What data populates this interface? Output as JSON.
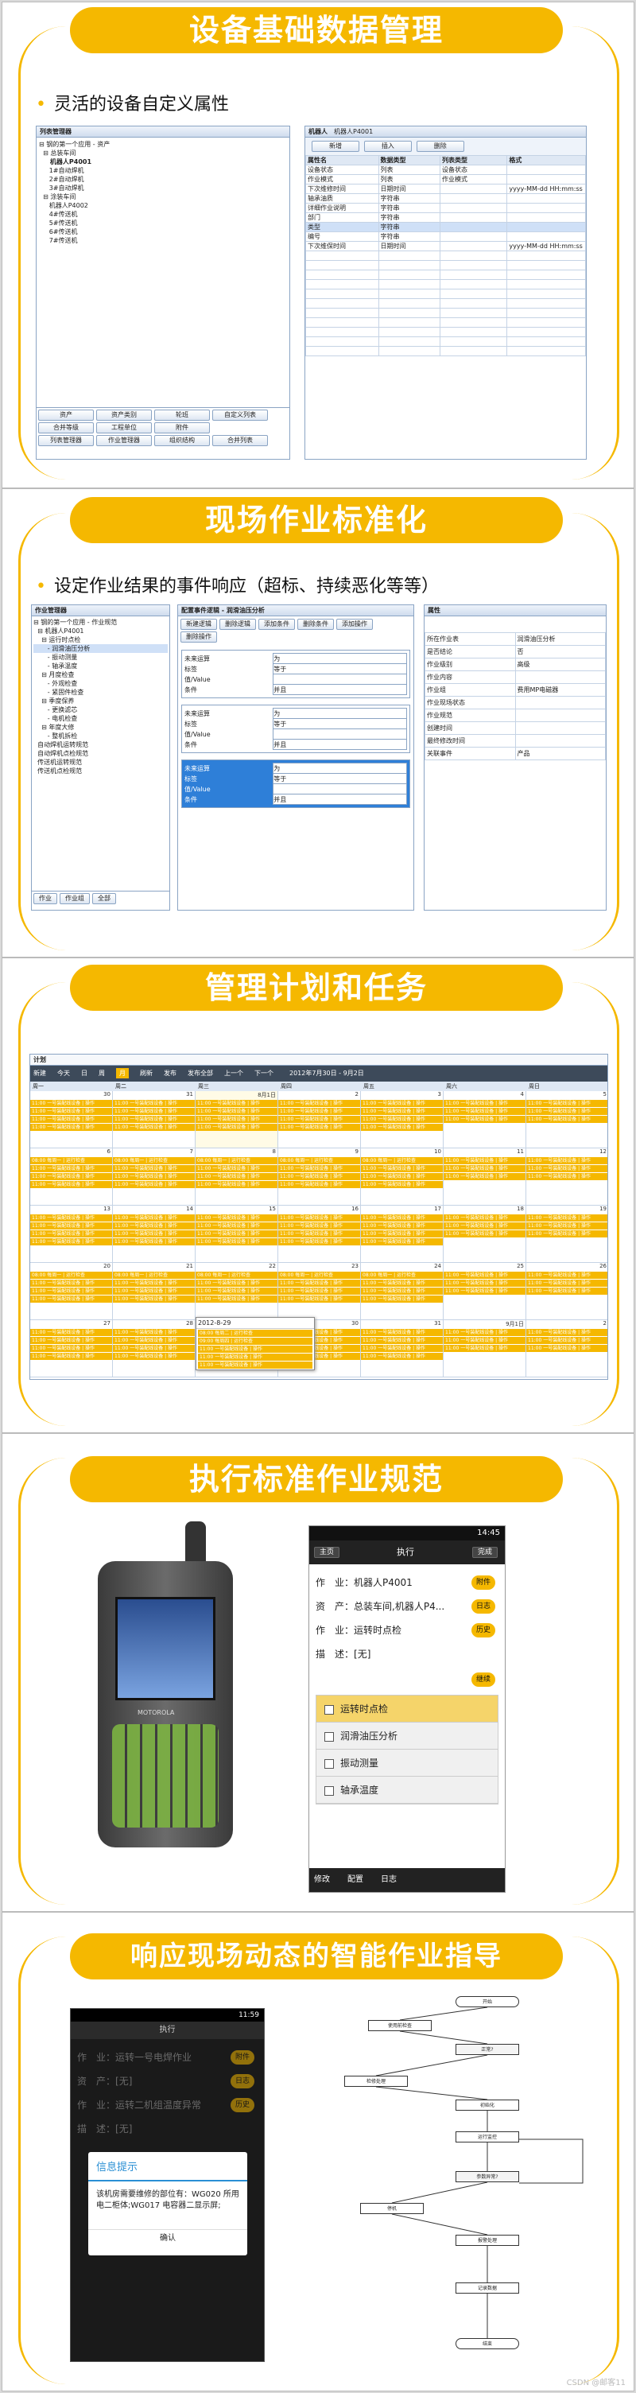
{
  "s1": {
    "title": "设备基础数据管理",
    "bullet": "灵活的设备自定义属性",
    "tree_title": "列表管理器",
    "tree": [
      "⊟ 钢的第一个应用 - 资产",
      "  ⊟ 总装车间",
      "     机器人P4001",
      "     1#自动焊机",
      "     2#自动焊机",
      "     3#自动焊机",
      "  ⊟ 涂装车间",
      "     机器人P4002",
      "     4#传送机",
      "     5#传送机",
      "     6#传送机",
      "     7#传送机"
    ],
    "tabs1": [
      "资产",
      "资产类别",
      "轮班",
      "自定义列表"
    ],
    "tabs2": [
      "合并等级",
      "工程单位",
      "附件"
    ],
    "tabs3": [
      "列表管理器",
      "作业管理器",
      "组织结构",
      "合并列表"
    ],
    "form_tab": "机器人",
    "form_tab2": "机器人P4001",
    "buttons": [
      "新增",
      "插入",
      "删除"
    ],
    "headers": [
      "属性名",
      "数据类型",
      "列表类型",
      "格式"
    ],
    "rows": [
      [
        "设备状态",
        "列表",
        "设备状态",
        ""
      ],
      [
        "作业模式",
        "列表",
        "作业模式",
        ""
      ],
      [
        "下次维修时间",
        "日期时间",
        "",
        "yyyy-MM-dd HH:mm:ss"
      ],
      [
        "轴承油质",
        "字符串",
        "",
        ""
      ],
      [
        "详细作业说明",
        "字符串",
        "",
        ""
      ],
      [
        "部门",
        "字符串",
        "",
        ""
      ],
      [
        "类型",
        "字符串",
        "",
        ""
      ],
      [
        "编号",
        "字符串",
        "",
        ""
      ],
      [
        "下次维保时间",
        "日期时间",
        "",
        "yyyy-MM-dd HH:mm:ss"
      ]
    ]
  },
  "s2": {
    "title": "现场作业标准化",
    "bullet": "设定作业结果的事件响应（超标、持续恶化等等）",
    "tree_title": "作业管理器",
    "tree": [
      "⊟ 钢的第一个应用 - 作业规范",
      "  ⊟ 机器人P4001",
      "    ⊟ 运行时点检",
      "       - 润滑油压分析",
      "       - 振动测量",
      "       - 轴承温度",
      "    ⊟ 月度检查",
      "       - 外观检查",
      "       - 紧固件检查",
      "    ⊟ 季度保养",
      "       - 更换滤芯",
      "       - 电机检查",
      "    ⊟ 年度大修",
      "       - 整机拆检",
      "  自动焊机运转规范",
      "  自动焊机点检规范",
      "  传送机运转规范",
      "  传送机点检规范"
    ],
    "dlg_title": "配置事件逻辑 - 润滑油压分析",
    "dlg_btns": [
      "新建逻辑",
      "删除逻辑",
      "添加条件",
      "删除条件",
      "添加操作",
      "删除操作"
    ],
    "cond_labels": [
      "未来运算",
      "标签",
      "值/Value",
      "条件"
    ],
    "ops": [
      "为",
      "等于",
      "",
      "并且",
      "非空"
    ],
    "right_hdr": "属性",
    "right_rows": [
      [
        "所在作业表",
        "润滑油压分析"
      ],
      [
        "是否结论",
        "否"
      ],
      [
        "作业级别",
        "高级"
      ],
      [
        "作业内容",
        ""
      ],
      [
        "作业组",
        "费用MP电磁器"
      ],
      [
        "作业现场状态",
        ""
      ],
      [
        "作业规范",
        ""
      ],
      [
        "创建时间",
        ""
      ],
      [
        "最终修改时间",
        ""
      ],
      [
        "关联事件",
        "产品"
      ]
    ],
    "bottom_tabs": [
      "作业",
      "作业组",
      "全部"
    ]
  },
  "s3": {
    "title": "管理计划和任务",
    "win_title": "计划",
    "toolbar": [
      "新建",
      "今天",
      "日",
      "周",
      "月",
      "刷新",
      "发布",
      "发布全部",
      "上一个",
      "下一个"
    ],
    "date_range": "2012年7月30日 - 9月2日",
    "weekdays": [
      "周一",
      "周二",
      "周三",
      "周四",
      "周五",
      "周六",
      "周日"
    ],
    "weeks": [
      [
        "30",
        "31",
        "8月1日",
        "2",
        "3",
        "4",
        "5"
      ],
      [
        "6",
        "7",
        "8",
        "9",
        "10",
        "11",
        "12"
      ],
      [
        "13",
        "14",
        "15",
        "16",
        "17",
        "18",
        "19"
      ],
      [
        "20",
        "21",
        "22",
        "23",
        "24",
        "25",
        "26"
      ],
      [
        "27",
        "28",
        "29",
        "30",
        "31",
        "9月1日",
        "2"
      ]
    ],
    "event": "11:00 一号装配线设备 | 操作",
    "event2": "08:00 每周一 | 运行检查",
    "popup_date": "2012-8-29",
    "popup_items": [
      "08:00 每周二 | 运行检查",
      "09:00 每周四 | 运行检查",
      "11:00 一号装配线设备 | 操作",
      "11:00 一号装配线设备 | 操作",
      "11:00 一号装配线设备 | 操作"
    ]
  },
  "s4": {
    "title": "执行标准作业规范",
    "status_time": "14:45",
    "nav_home": "主页",
    "nav_title": "执行",
    "nav_done": "完成",
    "fields": [
      [
        "作　业：",
        "机器人P4001",
        "附件"
      ],
      [
        "资　产：",
        "总装车间,机器人P4...",
        "日志"
      ],
      [
        "作　业：",
        "运转时点检",
        "历史"
      ],
      [
        "描　述：",
        "[无]",
        ""
      ]
    ],
    "next": "继续",
    "checklist": [
      "运转时点检",
      "润滑油压分析",
      "振动测量",
      "轴承温度"
    ],
    "bottom": [
      "修改",
      "配置",
      "日志"
    ],
    "device_brand": "MOTOROLA"
  },
  "s5": {
    "title": "响应现场动态的智能作业指导",
    "status_time": "11:59",
    "nav_title": "执行",
    "fields": [
      [
        "作　业：",
        "运转一号电焊作业",
        "附件"
      ],
      [
        "资　产：",
        "[无]",
        "日志"
      ],
      [
        "作　业：",
        "运转二机组温度异常",
        "历史"
      ],
      [
        "描　述：",
        "[无]",
        ""
      ]
    ],
    "dialog_title": "信息提示",
    "dialog_msg": "该机房需要维修的部位有：WG020 所用电二柜体;WG017 电容器二显示屏;",
    "dialog_ok": "确认",
    "flow": [
      "开始",
      "使用前检查",
      "正常?",
      "检修处理",
      "初始化",
      "运行监控",
      "参数异常?",
      "停机",
      "报警处理",
      "记录数据",
      "结束"
    ],
    "watermark": "CSDN @邮客11"
  }
}
